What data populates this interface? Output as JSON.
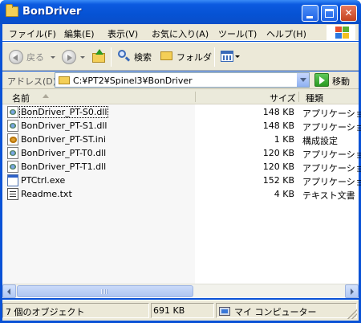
{
  "window": {
    "title": "BonDriver"
  },
  "menu": {
    "items": [
      "ファイル(F)",
      "編集(E)",
      "表示(V)",
      "お気に入り(A)",
      "ツール(T)",
      "ヘルプ(H)"
    ]
  },
  "toolbar": {
    "back_label": "戻る",
    "search_label": "検索",
    "folders_label": "フォルダ"
  },
  "address": {
    "label": "アドレス(D)",
    "value": "C:¥PT2¥Spinel3¥BonDriver",
    "go_label": "移動"
  },
  "columns": {
    "name": "名前",
    "size": "サイズ",
    "type": "種類"
  },
  "files": [
    {
      "name": "BonDriver_PT-S0.dll",
      "size": "148 KB",
      "type": "アプリケーション",
      "icon": "dll-icon"
    },
    {
      "name": "BonDriver_PT-S1.dll",
      "size": "148 KB",
      "type": "アプリケーション",
      "icon": "dll-icon"
    },
    {
      "name": "BonDriver_PT-ST.ini",
      "size": "1 KB",
      "type": "構成設定",
      "icon": "ini-icon"
    },
    {
      "name": "BonDriver_PT-T0.dll",
      "size": "120 KB",
      "type": "アプリケーション",
      "icon": "dll-icon"
    },
    {
      "name": "BonDriver_PT-T1.dll",
      "size": "120 KB",
      "type": "アプリケーション",
      "icon": "dll-icon"
    },
    {
      "name": "PTCtrl.exe",
      "size": "152 KB",
      "type": "アプリケーション",
      "icon": "exe-icon"
    },
    {
      "name": "Readme.txt",
      "size": "4 KB",
      "type": "テキスト文書",
      "icon": "txt-icon"
    }
  ],
  "status": {
    "count": "7 個のオブジェクト",
    "total_size": "691 KB",
    "location": "マイ コンピューター"
  },
  "colors": {
    "title_blue": "#0652d4",
    "chrome": "#ece9d8"
  }
}
